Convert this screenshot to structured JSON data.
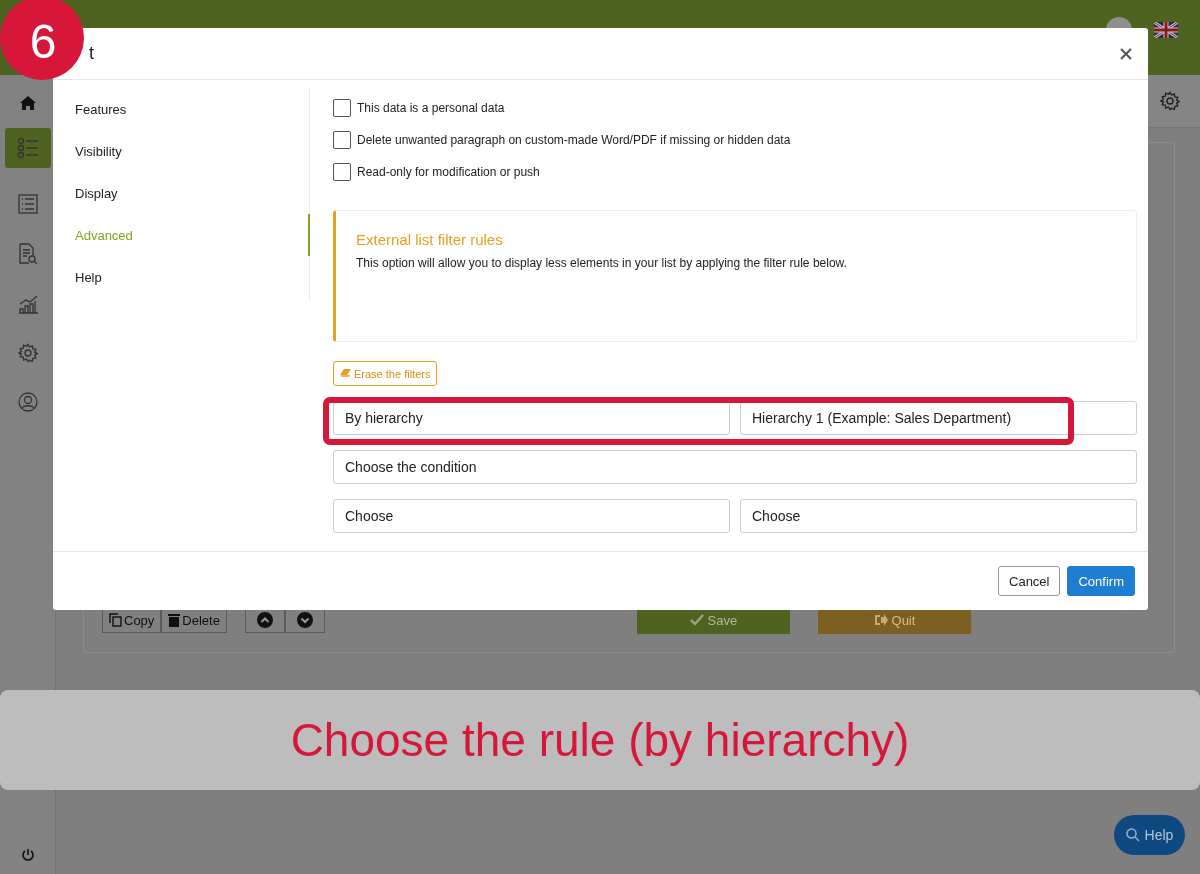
{
  "background": {
    "toolbar_buttons": [
      {
        "label": "Copy",
        "kind": "copy"
      },
      {
        "label": "Delete",
        "kind": "delete"
      }
    ],
    "move_buttons": [
      {
        "kind": "up"
      },
      {
        "kind": "down"
      }
    ],
    "action_buttons": [
      {
        "label": "Save",
        "kind": "save"
      },
      {
        "label": "Quit",
        "kind": "quit"
      }
    ],
    "help_button": {
      "label": "Help"
    }
  },
  "dialog": {
    "title": "t",
    "nav": [
      {
        "label": "Features",
        "selected": false
      },
      {
        "label": "Visibility",
        "selected": false
      },
      {
        "label": "Display",
        "selected": false
      },
      {
        "label": "Advanced",
        "selected": true
      },
      {
        "label": "Help",
        "selected": false
      }
    ],
    "options": [
      {
        "label": "This data is a personal data",
        "checked": false
      },
      {
        "label": "Delete unwanted paragraph on custom-made Word/PDF if missing or hidden data",
        "checked": false
      },
      {
        "label": "Read-only for modification or push",
        "checked": false
      }
    ],
    "info": {
      "title": "External list filter rules",
      "text": "This option will allow you to display less elements in your list by applying the filter rule below."
    },
    "erase_button": "Erase the filters",
    "filter_rows": [
      [
        {
          "value": "By hierarchy"
        },
        {
          "value": "Hierarchy 1 (Example: Sales Department)"
        }
      ],
      [
        {
          "value": "Choose the condition"
        }
      ],
      [
        {
          "value": "Choose"
        },
        {
          "value": "Choose"
        }
      ]
    ],
    "buttons": [
      {
        "label": "Cancel",
        "kind": "secondary"
      },
      {
        "label": "Confirm",
        "kind": "primary"
      }
    ]
  },
  "step_badge": "6",
  "caption": "Choose the rule (by hierarchy)"
}
